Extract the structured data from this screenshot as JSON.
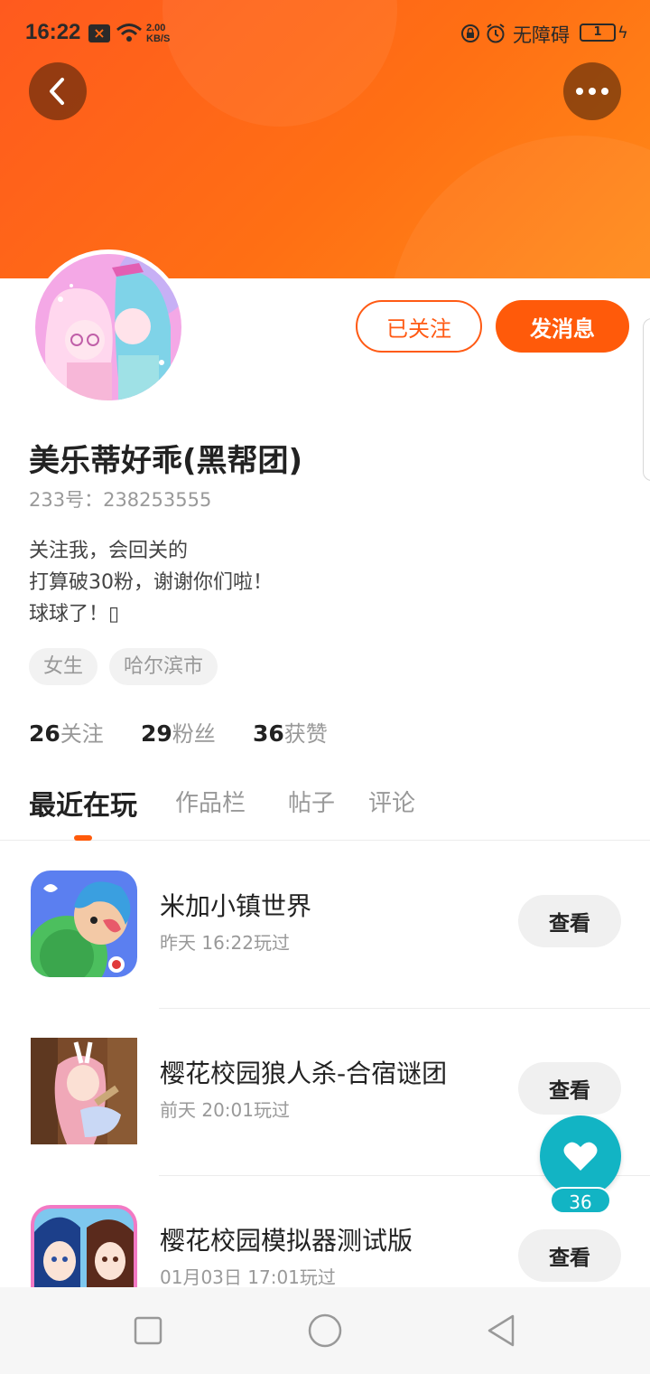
{
  "status_bar": {
    "time": "16:22",
    "notification_badge": "×",
    "speed_value": "2.00",
    "speed_unit": "KB/S",
    "accessibility_label": "无障碍",
    "battery": "1"
  },
  "profile": {
    "follow_label": "已关注",
    "message_label": "发消息",
    "username": "美乐蒂好乖(黑帮团)",
    "id_text": "233号：238253555",
    "bio_lines": [
      "关注我，会回关的",
      "打算破30粉，谢谢你们啦！",
      "球球了！▯"
    ],
    "tags": [
      "女生",
      "哈尔滨市"
    ],
    "stats": [
      {
        "value": "26",
        "label": "关注"
      },
      {
        "value": "29",
        "label": "粉丝"
      },
      {
        "value": "36",
        "label": "获赞"
      }
    ]
  },
  "tabs": [
    "最近在玩",
    "作品栏",
    "帖子",
    "评论"
  ],
  "games": [
    {
      "name": "米加小镇世界",
      "time": "昨天 16:22玩过",
      "action": "查看"
    },
    {
      "name": "樱花校园狼人杀-合宿谜团",
      "time": "前天 20:01玩过",
      "action": "查看"
    },
    {
      "name": "樱花校园模拟器测试版",
      "time": "01月03日 17:01玩过",
      "action": "查看"
    }
  ],
  "like": {
    "count": "36"
  },
  "icons": {
    "back": "chevron-left-icon",
    "more": "more-dots-icon",
    "like": "heart-icon",
    "nav": [
      "square-icon",
      "circle-icon",
      "triangle-back-icon"
    ]
  },
  "colors": {
    "accent": "#ff5a0a",
    "header_gradient_start": "#ff5a1e",
    "header_gradient_end": "#ff8a18",
    "like_fab": "#12b4c4"
  }
}
